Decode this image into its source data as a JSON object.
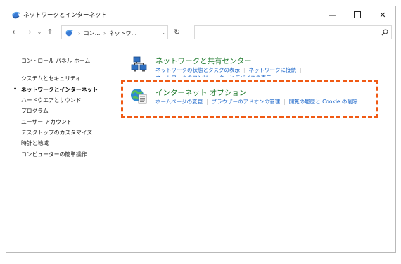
{
  "window": {
    "title": "ネットワークとインターネット"
  },
  "titlebar": {
    "minimize": "—",
    "close": "✕"
  },
  "address": {
    "back": "←",
    "forward": "→",
    "dropdown": "⌄",
    "up": "↑",
    "crumbs": [
      "コン...",
      "ネットワ..."
    ],
    "crumb_sep": "›",
    "dropdown_arrow": "⌄",
    "refresh": "↻"
  },
  "search": {
    "placeholder": ""
  },
  "sidebar": {
    "items": [
      {
        "label": "コントロール パネル ホーム"
      },
      {
        "label": "システムとセキュリティ"
      },
      {
        "label": "ネットワークとインターネット",
        "current": true
      },
      {
        "label": "ハードウエアとサウンド"
      },
      {
        "label": "プログラム"
      },
      {
        "label": "ユーザー アカウント"
      },
      {
        "label": "デスクトップのカスタマイズ"
      },
      {
        "label": "時計と地域"
      },
      {
        "label": "コンピューターの簡単操作"
      }
    ],
    "current_bullet": "•"
  },
  "sections": [
    {
      "title": "ネットワークと共有センター",
      "links": [
        "ネットワークの状態とタスクの表示",
        "ネットワークに接続"
      ],
      "links_row2": "ネットワークのコンピューターとデバイスの表示",
      "icon": "network-sharing-icon"
    },
    {
      "title": "インターネット オプション",
      "links": [
        "ホームページの変更",
        "ブラウザーのアドオンの管理",
        "閲覧の履歴と Cookie の削除"
      ],
      "icon": "internet-options-icon"
    }
  ],
  "divider": "|",
  "colors": {
    "section_title": "#1e7a2c",
    "link": "#1562c8",
    "highlight": "#f05a14",
    "border": "#b9b9b9"
  }
}
